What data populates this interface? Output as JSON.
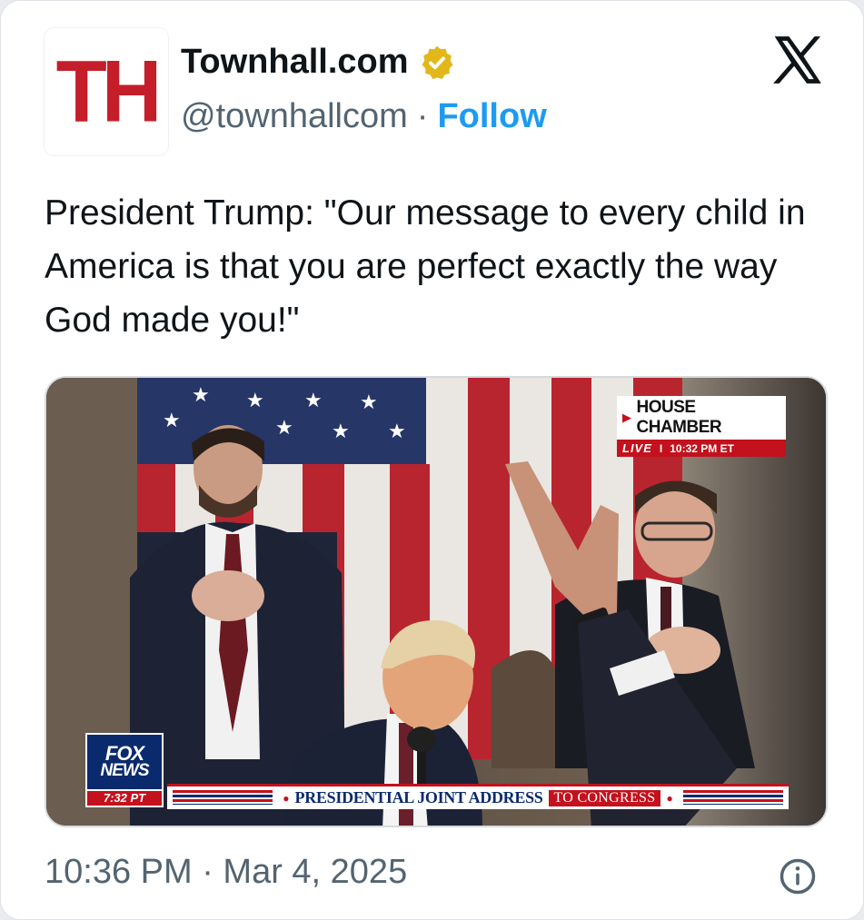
{
  "author": {
    "avatar_text": "TH",
    "display_name": "Townhall.com",
    "handle": "@townhallcom",
    "separator": "·",
    "follow_label": "Follow",
    "verified_icon": "gold-verified-badge-icon"
  },
  "platform_icon": "x-logo-icon",
  "tweet": {
    "text": "President Trump: \"Our message to every child in America is that you are perfect exactly the way God made you!\""
  },
  "media": {
    "chyron_location": "HOUSE CHAMBER",
    "chyron_live": "LIVE",
    "chyron_divider": "I",
    "chyron_time": "10:32 PM ET",
    "network_line1": "FOX",
    "network_line2": "NEWS",
    "network_time": "7:32 PT",
    "lower_third_main": "PRESIDENTIAL JOINT ADDRESS",
    "lower_third_tag": "TO CONGRESS"
  },
  "footer": {
    "timestamp": "10:36 PM · Mar 4, 2025",
    "info_icon": "info-icon"
  },
  "colors": {
    "follow_blue": "#1d9bf0",
    "verified_gold": "#e2b719",
    "townhall_red": "#c41e2a",
    "fox_blue": "#0b2a6e",
    "fox_red": "#c3111d",
    "secondary_text": "#536471"
  }
}
